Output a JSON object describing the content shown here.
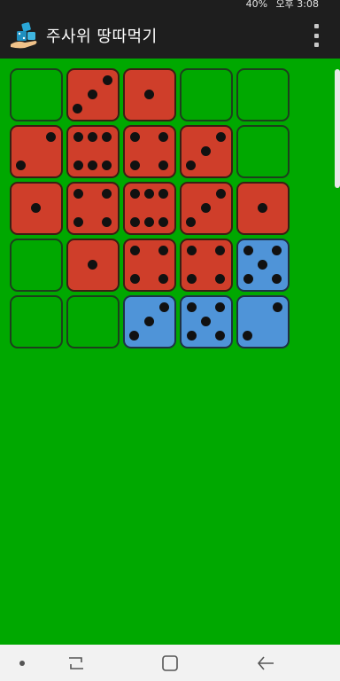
{
  "status_bar": {
    "battery": "40%",
    "time": "오후 3:08"
  },
  "app_bar": {
    "title": "주사위 땅따먹기",
    "menu_icon": "overflow-menu-icon",
    "logo_icon": "dice-in-hand-icon"
  },
  "colors": {
    "background": "#00a800",
    "red_die": "#cf3e2a",
    "blue_die": "#4f94d8",
    "bar": "#1e1e1e"
  },
  "board": {
    "rows": 5,
    "cols": 5,
    "cells": [
      [
        {
          "color": "empty"
        },
        {
          "color": "red",
          "value": 3
        },
        {
          "color": "red",
          "value": 1
        },
        {
          "color": "empty"
        },
        {
          "color": "empty"
        }
      ],
      [
        {
          "color": "red",
          "value": 2
        },
        {
          "color": "red",
          "value": 6
        },
        {
          "color": "red",
          "value": 4
        },
        {
          "color": "red",
          "value": 3
        },
        {
          "color": "empty"
        }
      ],
      [
        {
          "color": "red",
          "value": 1
        },
        {
          "color": "red",
          "value": 4
        },
        {
          "color": "red",
          "value": 6
        },
        {
          "color": "red",
          "value": 3
        },
        {
          "color": "red",
          "value": 1
        }
      ],
      [
        {
          "color": "empty"
        },
        {
          "color": "red",
          "value": 1
        },
        {
          "color": "red",
          "value": 4
        },
        {
          "color": "red",
          "value": 4
        },
        {
          "color": "blue",
          "value": 5
        }
      ],
      [
        {
          "color": "empty"
        },
        {
          "color": "empty"
        },
        {
          "color": "blue",
          "value": 3
        },
        {
          "color": "blue",
          "value": 5
        },
        {
          "color": "blue",
          "value": 2
        }
      ]
    ]
  },
  "nav_bar": {
    "items": [
      {
        "name": "nav-dot-button",
        "icon": "dot-icon"
      },
      {
        "name": "recent-apps-button",
        "icon": "recent-apps-icon"
      },
      {
        "name": "home-button",
        "icon": "home-square-icon"
      },
      {
        "name": "back-button",
        "icon": "back-arrow-icon"
      }
    ]
  }
}
